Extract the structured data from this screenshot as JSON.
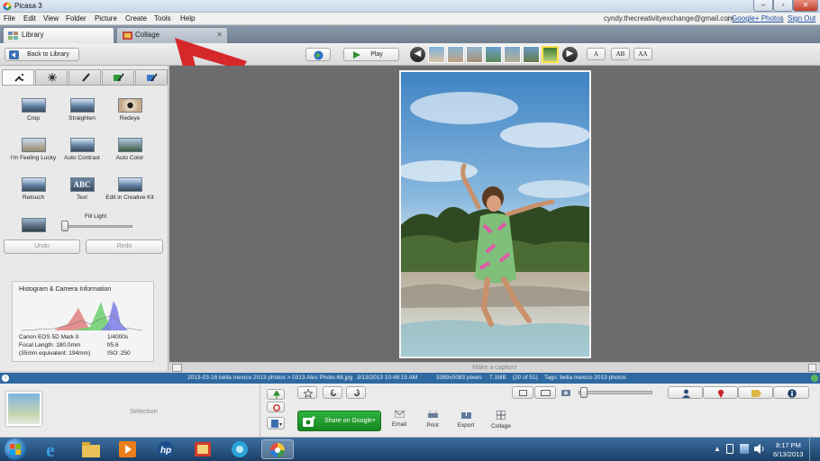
{
  "window": {
    "title": "Picasa 3"
  },
  "menu": [
    "File",
    "Edit",
    "View",
    "Folder",
    "Picture",
    "Create",
    "Tools",
    "Help"
  ],
  "account": {
    "email": "cyndy.thecreativityexchange@gmail.com",
    "google_photos": "Google+ Photos",
    "sign_out": "Sign Out"
  },
  "tabs": [
    {
      "label": "Library"
    },
    {
      "label": "Collage"
    }
  ],
  "toolbar": {
    "back_label": "Back to Library",
    "play_label": "Play",
    "caption_modes": [
      "A",
      "AB",
      "AA"
    ]
  },
  "tools": [
    {
      "label": "Crop"
    },
    {
      "label": "Straighten"
    },
    {
      "label": "Redeye"
    },
    {
      "label": "I'm Feeling Lucky"
    },
    {
      "label": "Auto Contrast"
    },
    {
      "label": "Auto Color"
    },
    {
      "label": "Retouch"
    },
    {
      "label": "Text"
    },
    {
      "label": "Edit in Creative Kit"
    }
  ],
  "fill_light": {
    "label": "Fill Light",
    "value": 0.0
  },
  "edit": {
    "undo": "Undo",
    "redo": "Redo"
  },
  "histogram": {
    "title": "Histogram & Camera Information",
    "camera": [
      {
        "left": "Canon EOS 5D Mark II",
        "right": "1/4000s"
      },
      {
        "left": "Focal Length: 180.0mm",
        "right": "f/5.6"
      },
      {
        "left": "(35mm equivalent: 194mm)",
        "right": "ISO: 250"
      }
    ]
  },
  "caption": {
    "placeholder": "Make a caption!"
  },
  "infobar": {
    "path": "2013-03-16 bella mexico 2013 photos > 0313 Ales Photo-68.jpg",
    "date": "3/13/2013 10:48:15 AM",
    "dimensions": "3389x5083 pixels",
    "size": "7.1MB",
    "position": "(20 of 51)",
    "tags": "Tags: bella mexico 2013 photos"
  },
  "tray": {
    "selection_label": "Selection"
  },
  "actions": {
    "share": "Share on Google+",
    "email": "Email",
    "print": "Print",
    "export": "Export",
    "collage": "Collage"
  },
  "clock": {
    "time": "8:17 PM",
    "date": "6/13/2013"
  },
  "colors": {
    "accent_blue": "#2f69a2",
    "share_green": "#1d9a2a",
    "annotation_arrow": "#d5282a"
  }
}
